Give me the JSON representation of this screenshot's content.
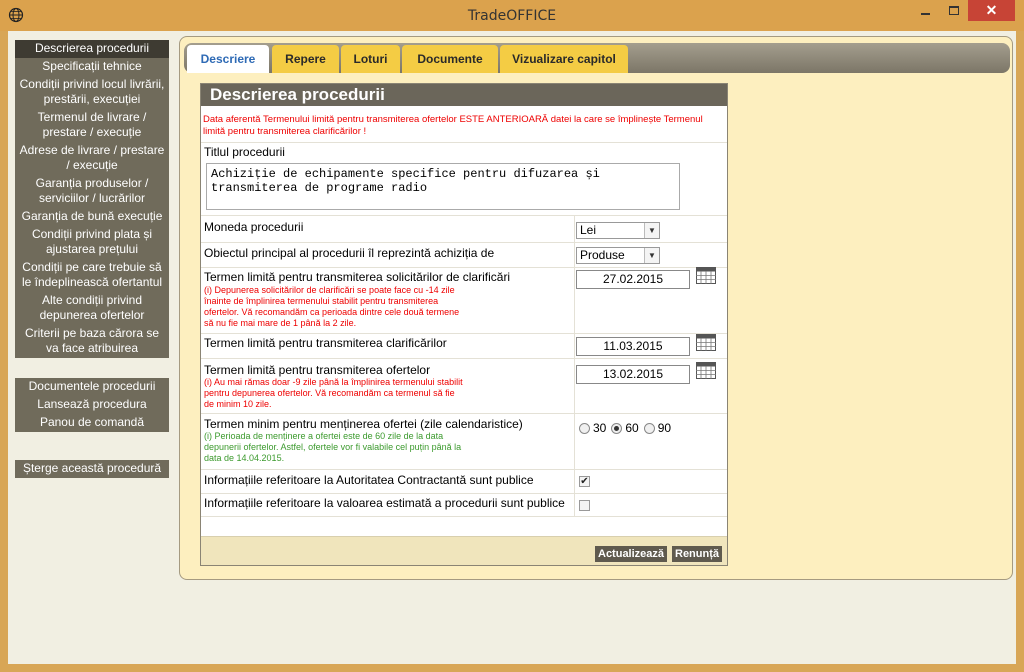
{
  "window": {
    "title": "TradeOFFICE",
    "close_glyph": "✕",
    "icon": "globe-icon"
  },
  "sidebar": {
    "items": [
      {
        "label": "Descrierea procedurii"
      },
      {
        "label": "Specificații tehnice"
      },
      {
        "label": "Condiții privind locul livrării, prestării, execuției"
      },
      {
        "label": "Termenul de livrare / prestare / execuție"
      },
      {
        "label": "Adrese de livrare / prestare / execuție"
      },
      {
        "label": "Garanția produselor / serviciilor / lucrărilor"
      },
      {
        "label": "Garanția de bună execuție"
      },
      {
        "label": "Condiții privind plata și ajustarea prețului"
      },
      {
        "label": "Condiții pe care trebuie să le îndeplinească ofertantul"
      },
      {
        "label": "Alte condiții privind depunerea ofertelor"
      },
      {
        "label": "Criterii pe baza cărora se va face atribuirea"
      }
    ],
    "actions": [
      {
        "label": "Documentele procedurii"
      },
      {
        "label": "Lansează procedura"
      },
      {
        "label": "Panou de comandă"
      }
    ],
    "delete_label": "Șterge această procedură"
  },
  "tabs": [
    {
      "label": "Descriere"
    },
    {
      "label": "Repere"
    },
    {
      "label": "Loturi"
    },
    {
      "label": "Documente"
    },
    {
      "label": "Vizualizare capitol"
    }
  ],
  "form": {
    "title": "Descrierea procedurii",
    "warning": "Data aferentă Termenului limită pentru transmiterea ofertelor ESTE ANTERIOARĂ datei la care se împlinește Termenul limită pentru transmiterea clarificărilor !",
    "title_label": "Titlul procedurii",
    "title_value": "Achiziție de echipamente specifice pentru difuzarea și transmiterea de programe radio",
    "currency_label": "Moneda procedurii",
    "currency_value": "Lei",
    "object_label": "Obiectul principal al procedurii îl reprezintă achiziția de",
    "object_value": "Produse",
    "clar_req_label": "Termen limită pentru transmiterea solicitărilor de clarificări",
    "clar_req_hint": "(i) Depunerea solicitărilor de clarificări se poate face cu -14 zile înainte de împlinirea termenului stabilit pentru transmiterea ofertelor. Vă recomandăm ca perioada dintre cele două termene să nu fie mai mare de 1 până la 2 zile.",
    "clar_req_date": "27.02.2015",
    "clar_label": "Termen limită pentru transmiterea clarificărilor",
    "clar_date": "11.03.2015",
    "offers_label": "Termen limită pentru transmiterea ofertelor",
    "offers_hint": "(i) Au mai rămas doar -9 zile până la împlinirea termenului stabilit pentru depunerea ofertelor. Vă recomandăm ca termenul să fie de minim 10 zile.",
    "offers_date": "13.02.2015",
    "validity_label": "Termen minim pentru menținerea ofertei (zile calendaristice)",
    "validity_hint": "(i) Perioada de menținere a ofertei este de 60 zile de la data depunerii ofertelor. Astfel, ofertele vor fi valabile cel puțin până la data de 14.04.2015.",
    "validity_options": [
      "30",
      "60",
      "90"
    ],
    "validity_selected": "60",
    "public_ac_label": "Informațiile referitoare la Autoritatea Contractantă sunt publice",
    "public_ac_checked": true,
    "public_value_label": "Informațiile referitoare la valoarea estimată a procedurii sunt publice",
    "public_value_checked": false,
    "update_label": "Actualizează",
    "cancel_label": "Renunță",
    "check_glyph": "✔",
    "dropdown_glyph": "▼"
  }
}
